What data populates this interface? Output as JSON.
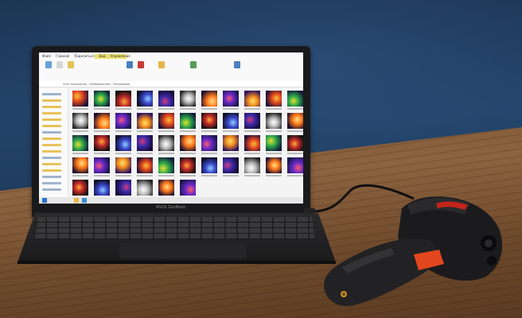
{
  "scene": {
    "description_labels": {
      "laptop_brand": "ASUS ZenBook"
    },
    "colors": {
      "wall": "#1f3d5f",
      "table": "#7a5434",
      "camera_body": "#1b1b1d",
      "camera_accent": "#e2461d",
      "camera_red_trim": "#c4241a"
    }
  },
  "explorer": {
    "ribbon_tabs": [
      "Файл",
      "Главная",
      "Поделиться",
      "Вид"
    ],
    "ribbon_context_tab": "Управление",
    "address": "Этот компьютер › Изображения › Тепловизор",
    "thumbnail_captions": [
      "1.jpg",
      "2",
      "3",
      "4",
      "5",
      "6",
      "7",
      "8",
      "9",
      "10",
      "11",
      "12"
    ],
    "status_icons": [
      "folder-icon",
      "edge-icon",
      "explorer-icon"
    ]
  }
}
